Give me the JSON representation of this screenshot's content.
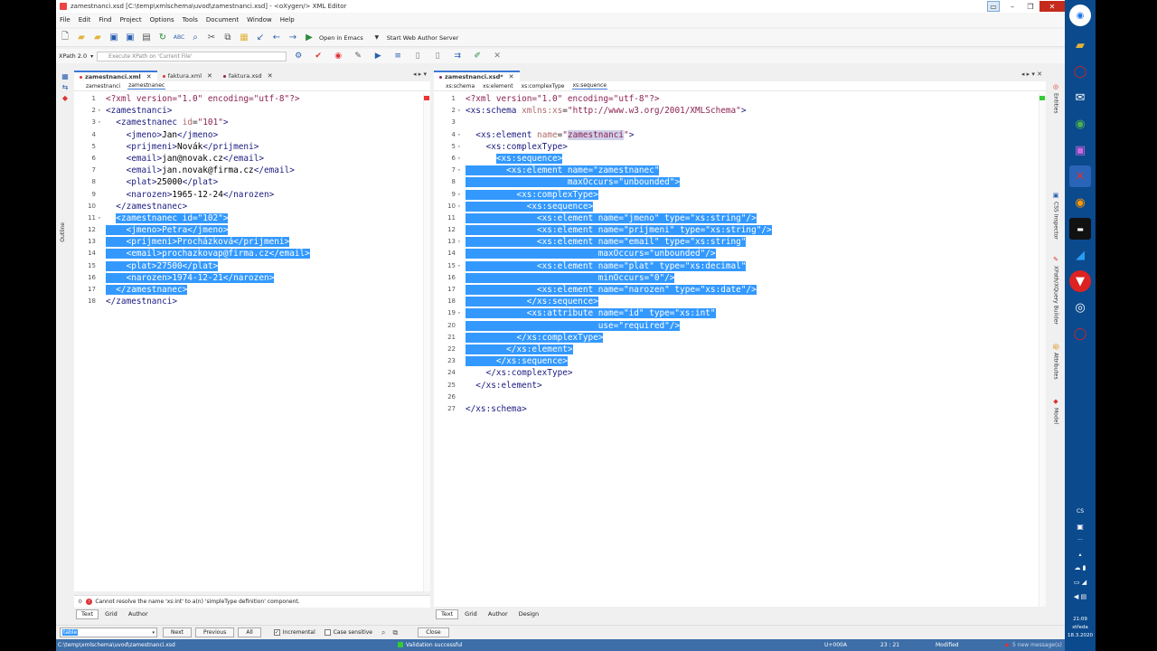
{
  "window": {
    "title": "zamestnanci.xsd [C:\\temp\\xmlschema\\uvod\\zamestnanci.xsd] - <oXygen/> XML Editor"
  },
  "menu": [
    "File",
    "Edit",
    "Find",
    "Project",
    "Options",
    "Tools",
    "Document",
    "Window",
    "Help"
  ],
  "toolbar": {
    "open_emacs": "Open in Emacs",
    "start_web_author": "Start Web Author Server"
  },
  "xpath": {
    "version": "XPath 2.0",
    "placeholder": "Execute XPath on 'Current File'"
  },
  "left_pane": {
    "tabs": [
      {
        "label": "zamestnanci.xml",
        "active": true
      },
      {
        "label": "faktura.xml",
        "active": false
      },
      {
        "label": "faktura.xsd",
        "active": false
      }
    ],
    "breadcrumb": [
      "zamestnanci",
      "zamestnanec"
    ],
    "lines": [
      {
        "n": "1",
        "text": "<?xml version=\"1.0\" encoding=\"utf-8\"?>"
      },
      {
        "n": "2",
        "text": "<zamestnanci>"
      },
      {
        "n": "3",
        "text": "  <zamestnanec id=\"101\">"
      },
      {
        "n": "4",
        "text": "    <jmeno>Jan</jmeno>"
      },
      {
        "n": "5",
        "text": "    <prijmeni>Novák</prijmeni>"
      },
      {
        "n": "6",
        "text": "    <email>jan@novak.cz</email>"
      },
      {
        "n": "7",
        "text": "    <email>jan.novak@firma.cz</email>"
      },
      {
        "n": "8",
        "text": "    <plat>25000</plat>"
      },
      {
        "n": "9",
        "text": "    <narozen>1965-12-24</narozen>"
      },
      {
        "n": "10",
        "text": "  </zamestnanec>"
      },
      {
        "n": "11",
        "text": "  <zamestnanec id=\"102\">"
      },
      {
        "n": "12",
        "text": "    <jmeno>Petra</jmeno>"
      },
      {
        "n": "13",
        "text": "    <prijmeni>Procházková</prijmeni>"
      },
      {
        "n": "14",
        "text": "    <email>prochazkovap@firma.cz</email>"
      },
      {
        "n": "15",
        "text": "    <plat>27500</plat>"
      },
      {
        "n": "16",
        "text": "    <narozen>1974-12-21</narozen>"
      },
      {
        "n": "17",
        "text": "  </zamestnanec>"
      },
      {
        "n": "18",
        "text": "</zamestnanci>"
      }
    ],
    "problem": "Cannot resolve the name 'xs:int' to a(n) 'simpleType definition' component.",
    "modes": [
      "Text",
      "Grid",
      "Author"
    ]
  },
  "right_pane": {
    "tabs": [
      {
        "label": "zamestnanci.xsd*",
        "active": true
      }
    ],
    "breadcrumb": [
      "xs:schema",
      "xs:element",
      "xs:complexType",
      "xs:sequence"
    ],
    "lines": [
      {
        "n": "1",
        "text": "<?xml version=\"1.0\" encoding=\"utf-8\"?>"
      },
      {
        "n": "2",
        "text": "<xs:schema xmlns:xs=\"http://www.w3.org/2001/XMLSchema\">"
      },
      {
        "n": "3",
        "text": ""
      },
      {
        "n": "4",
        "text": "  <xs:element name=\"zamestnanci\">"
      },
      {
        "n": "5",
        "text": "    <xs:complexType>"
      },
      {
        "n": "6",
        "text": "      <xs:sequence>"
      },
      {
        "n": "7",
        "text": "        <xs:element name=\"zamestnanec\""
      },
      {
        "n": "8",
        "text": "                    maxOccurs=\"unbounded\">"
      },
      {
        "n": "9",
        "text": "          <xs:complexType>"
      },
      {
        "n": "10",
        "text": "            <xs:sequence>"
      },
      {
        "n": "11",
        "text": "              <xs:element name=\"jmeno\" type=\"xs:string\"/>"
      },
      {
        "n": "12",
        "text": "              <xs:element name=\"prijmeni\" type=\"xs:string\"/>"
      },
      {
        "n": "13",
        "text": "              <xs:element name=\"email\" type=\"xs:string\""
      },
      {
        "n": "14",
        "text": "                          maxOccurs=\"unbounded\"/>"
      },
      {
        "n": "15",
        "text": "              <xs:element name=\"plat\" type=\"xs:decimal\""
      },
      {
        "n": "16",
        "text": "                          minOccurs=\"0\"/>"
      },
      {
        "n": "17",
        "text": "              <xs:element name=\"narozen\" type=\"xs:date\"/>"
      },
      {
        "n": "18",
        "text": "            </xs:sequence>"
      },
      {
        "n": "19",
        "text": "            <xs:attribute name=\"id\" type=\"xs:int\""
      },
      {
        "n": "20",
        "text": "                          use=\"required\"/>"
      },
      {
        "n": "21",
        "text": "          </xs:complexType>"
      },
      {
        "n": "22",
        "text": "        </xs:element>"
      },
      {
        "n": "23",
        "text": "      </xs:sequence>"
      },
      {
        "n": "24",
        "text": "    </xs:complexType>"
      },
      {
        "n": "25",
        "text": "  </xs:element>"
      },
      {
        "n": "26",
        "text": ""
      },
      {
        "n": "27",
        "text": "</xs:schema>"
      }
    ],
    "modes": [
      "Text",
      "Grid",
      "Author",
      "Design"
    ]
  },
  "side_views_left": [
    "Outline"
  ],
  "side_views_right": [
    "Entities",
    "CSS Inspector",
    "XPath/XQuery Builder",
    "Attributes",
    "Model"
  ],
  "find": {
    "value": "table",
    "next": "Next",
    "previous": "Previous",
    "all": "All",
    "incremental": "Incremental",
    "case_sensitive": "Case sensitive",
    "close": "Close"
  },
  "status": {
    "path": "C:\\temp\\xmlschema\\uvod\\zamestnanci.xsd",
    "validation": "Validation successful",
    "unicode": "U+000A",
    "position": "23 : 21",
    "modified": "Modified",
    "messages": "5 new message(s)"
  },
  "taskbar": {
    "lang": "CS",
    "time": "21:09",
    "day": "středa",
    "date": "18.3.2020"
  }
}
